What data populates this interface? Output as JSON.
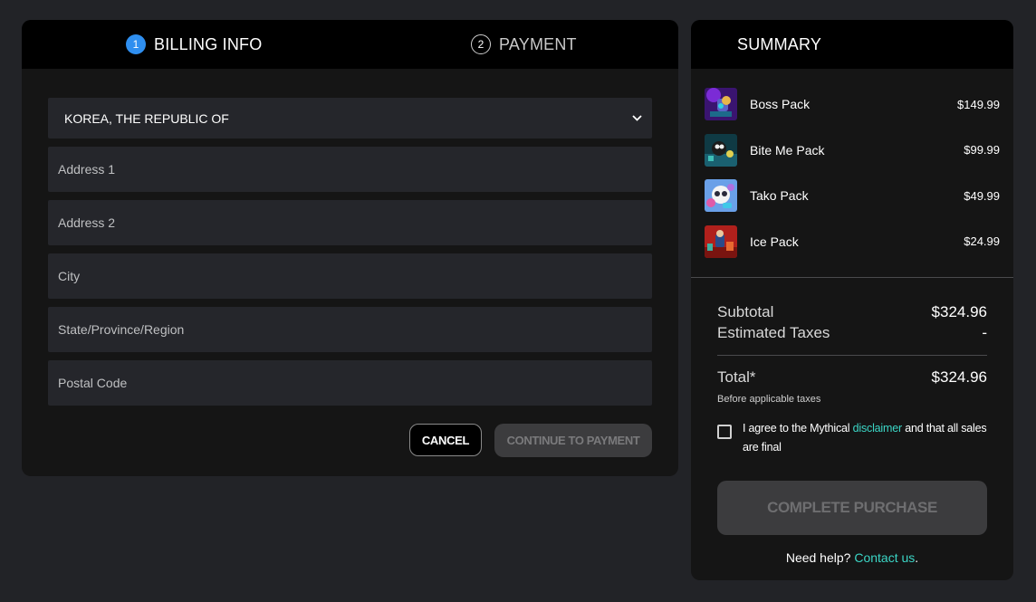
{
  "billing": {
    "steps": [
      {
        "number": "1",
        "label": "BILLING INFO"
      },
      {
        "number": "2",
        "label": "PAYMENT"
      }
    ],
    "country": "KOREA, THE REPUBLIC OF",
    "fields": {
      "address1_placeholder": "Address 1",
      "address2_placeholder": "Address 2",
      "city_placeholder": "City",
      "state_placeholder": "State/Province/Region",
      "postal_placeholder": "Postal Code"
    },
    "cancel_label": "CANCEL",
    "continue_label": "CONTINUE TO PAYMENT"
  },
  "summary": {
    "title": "SUMMARY",
    "items": [
      {
        "name": "Boss Pack",
        "price": "$149.99",
        "thumb_icon": "boss-pack-thumbnail"
      },
      {
        "name": "Bite Me Pack",
        "price": "$99.99",
        "thumb_icon": "bite-me-pack-thumbnail"
      },
      {
        "name": "Tako Pack",
        "price": "$49.99",
        "thumb_icon": "tako-pack-thumbnail"
      },
      {
        "name": "Ice Pack",
        "price": "$24.99",
        "thumb_icon": "ice-pack-thumbnail"
      }
    ],
    "subtotal_label": "Subtotal",
    "subtotal_value": "$324.96",
    "taxes_label": "Estimated Taxes",
    "taxes_value": "-",
    "total_label": "Total*",
    "total_value": "$324.96",
    "before_taxes": "Before applicable taxes",
    "agree_prefix": "I agree to the Mythical ",
    "agree_link": "disclaimer",
    "agree_suffix": " and that all sales are final",
    "complete_label": "COMPLETE PURCHASE",
    "help_prefix": "Need help? ",
    "help_link": "Contact us",
    "help_suffix": "."
  },
  "colors": {
    "page_bg": "#222327",
    "panel_bg": "#151515",
    "header_bg": "#000000",
    "field_bg": "#25262b",
    "active_step": "#2f8ff0",
    "link": "#3bd6c6",
    "disabled_button": "#3c3c3e"
  }
}
